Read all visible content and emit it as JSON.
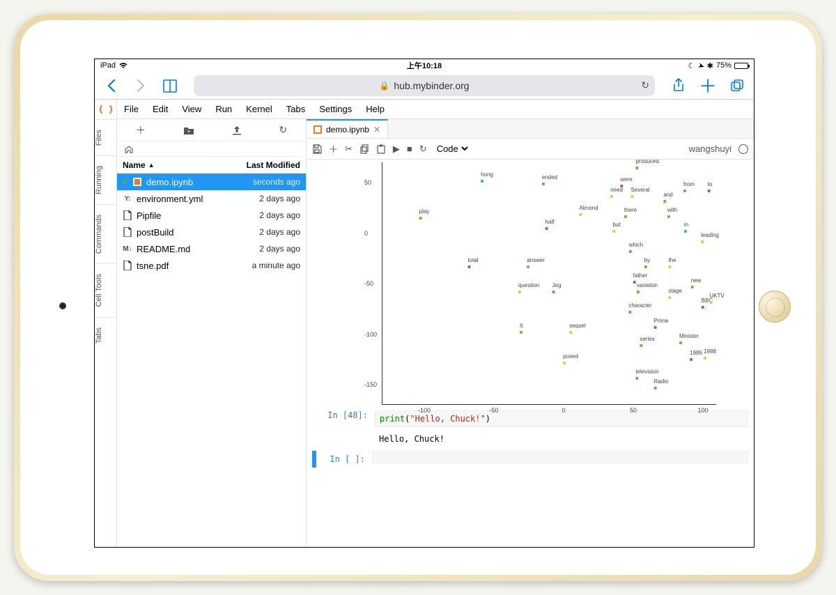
{
  "status": {
    "device": "iPad",
    "time": "上午10:18",
    "battery_pct": "75%",
    "moon": "☾",
    "nav": "➤",
    "bt": "✱"
  },
  "safari": {
    "url": "hub.mybinder.org"
  },
  "menu": {
    "items": [
      "File",
      "Edit",
      "View",
      "Run",
      "Kernel",
      "Tabs",
      "Settings",
      "Help"
    ]
  },
  "side_tabs": [
    "Files",
    "Running",
    "Commands",
    "Cell Tools",
    "Tabs"
  ],
  "files": {
    "header_name": "Name",
    "header_mod": "Last Modified",
    "rows": [
      {
        "icon": "nb",
        "name": "demo.ipynb",
        "mod": "seconds ago",
        "selected": true,
        "running": true
      },
      {
        "icon": "yml",
        "name": "environment.yml",
        "mod": "2 days ago"
      },
      {
        "icon": "file",
        "name": "Pipfile",
        "mod": "2 days ago"
      },
      {
        "icon": "file",
        "name": "postBuild",
        "mod": "2 days ago"
      },
      {
        "icon": "md",
        "name": "README.md",
        "mod": "2 days ago"
      },
      {
        "icon": "file",
        "name": "tsne.pdf",
        "mod": "a minute ago"
      }
    ]
  },
  "notebook": {
    "tab_label": "demo.ipynb",
    "cell_type": "Code",
    "user": "wangshuyi",
    "code48_prompt": "In [48]:",
    "code48_code": {
      "fn": "print",
      "open": "(",
      "str": "\"Hello, Chuck!\"",
      "close": ")"
    },
    "out48": "Hello, Chuck!",
    "empty_prompt": "In [ ]:"
  },
  "chart_data": {
    "type": "scatter",
    "title": "",
    "xlabel": "",
    "ylabel": "",
    "xlim": [
      -130,
      110
    ],
    "ylim": [
      -170,
      70
    ],
    "xticks": [
      -100,
      -50,
      0,
      50,
      100
    ],
    "yticks": [
      -150,
      -100,
      -50,
      0,
      50
    ],
    "points": [
      {
        "label": "produced",
        "x": 60,
        "y": 68,
        "c": "#e08030"
      },
      {
        "label": "hong",
        "x": -55,
        "y": 55,
        "c": "#4aa3df"
      },
      {
        "label": "ended",
        "x": -10,
        "y": 52,
        "c": "#4aa3df"
      },
      {
        "label": "were",
        "x": 45,
        "y": 50,
        "c": "#c94f7c"
      },
      {
        "label": "from",
        "x": 90,
        "y": 45,
        "c": "#7cb342"
      },
      {
        "label": "to",
        "x": 105,
        "y": 45,
        "c": "#c94f7c"
      },
      {
        "label": "need",
        "x": 38,
        "y": 40,
        "c": "#e6c84f"
      },
      {
        "label": "Several",
        "x": 55,
        "y": 40,
        "c": "#e6c84f"
      },
      {
        "label": "and",
        "x": 75,
        "y": 35,
        "c": "#e08030"
      },
      {
        "label": "play",
        "x": -100,
        "y": 18,
        "c": "#e08030"
      },
      {
        "label": "Almond",
        "x": 18,
        "y": 22,
        "c": "#e6c84f"
      },
      {
        "label": "there",
        "x": 48,
        "y": 20,
        "c": "#7cb342"
      },
      {
        "label": "with",
        "x": 78,
        "y": 20,
        "c": "#7cb342"
      },
      {
        "label": "half",
        "x": -10,
        "y": 8,
        "c": "#c94f7c"
      },
      {
        "label": "but",
        "x": 38,
        "y": 5,
        "c": "#e6c84f"
      },
      {
        "label": "in",
        "x": 88,
        "y": 5,
        "c": "#4aa3df"
      },
      {
        "label": "leading",
        "x": 105,
        "y": -5,
        "c": "#e6c84f"
      },
      {
        "label": "which",
        "x": 52,
        "y": -15,
        "c": "#4aa3df"
      },
      {
        "label": "total",
        "x": -65,
        "y": -30,
        "c": "#c94f7c"
      },
      {
        "label": "answer",
        "x": -20,
        "y": -30,
        "c": "#7cb342"
      },
      {
        "label": "by",
        "x": 60,
        "y": -30,
        "c": "#e08030"
      },
      {
        "label": "the",
        "x": 78,
        "y": -30,
        "c": "#e6c84f"
      },
      {
        "label": "father",
        "x": 55,
        "y": -45,
        "c": "#c94f7c"
      },
      {
        "label": "question",
        "x": -25,
        "y": -55,
        "c": "#e6c84f"
      },
      {
        "label": "Jeg",
        "x": -5,
        "y": -55,
        "c": "#4aa3df"
      },
      {
        "label": "variation",
        "x": 60,
        "y": -55,
        "c": "#e08030"
      },
      {
        "label": "new",
        "x": 95,
        "y": -50,
        "c": "#7cb342"
      },
      {
        "label": "stage",
        "x": 80,
        "y": -60,
        "c": "#e6c84f"
      },
      {
        "label": "character",
        "x": 55,
        "y": -75,
        "c": "#4aa3df"
      },
      {
        "label": "BBC",
        "x": 103,
        "y": -70,
        "c": "#c94f7c"
      },
      {
        "label": "UKTV",
        "x": 110,
        "y": -65,
        "c": "#e6c84f"
      },
      {
        "label": "It",
        "x": -30,
        "y": -95,
        "c": "#7cb342"
      },
      {
        "label": "sequel",
        "x": 10,
        "y": -95,
        "c": "#e6c84f"
      },
      {
        "label": "Prime",
        "x": 70,
        "y": -90,
        "c": "#c94f7c"
      },
      {
        "label": "series",
        "x": 60,
        "y": -108,
        "c": "#e08030"
      },
      {
        "label": "Minister",
        "x": 90,
        "y": -105,
        "c": "#7cb342"
      },
      {
        "label": "posed",
        "x": 5,
        "y": -125,
        "c": "#e6c84f"
      },
      {
        "label": "1986",
        "x": 95,
        "y": -122,
        "c": "#c94f7c"
      },
      {
        "label": "1988",
        "x": 105,
        "y": -120,
        "c": "#e6c84f"
      },
      {
        "label": "television",
        "x": 60,
        "y": -140,
        "c": "#4aa3df"
      },
      {
        "label": "Radio",
        "x": 70,
        "y": -150,
        "c": "#e08030"
      }
    ]
  }
}
